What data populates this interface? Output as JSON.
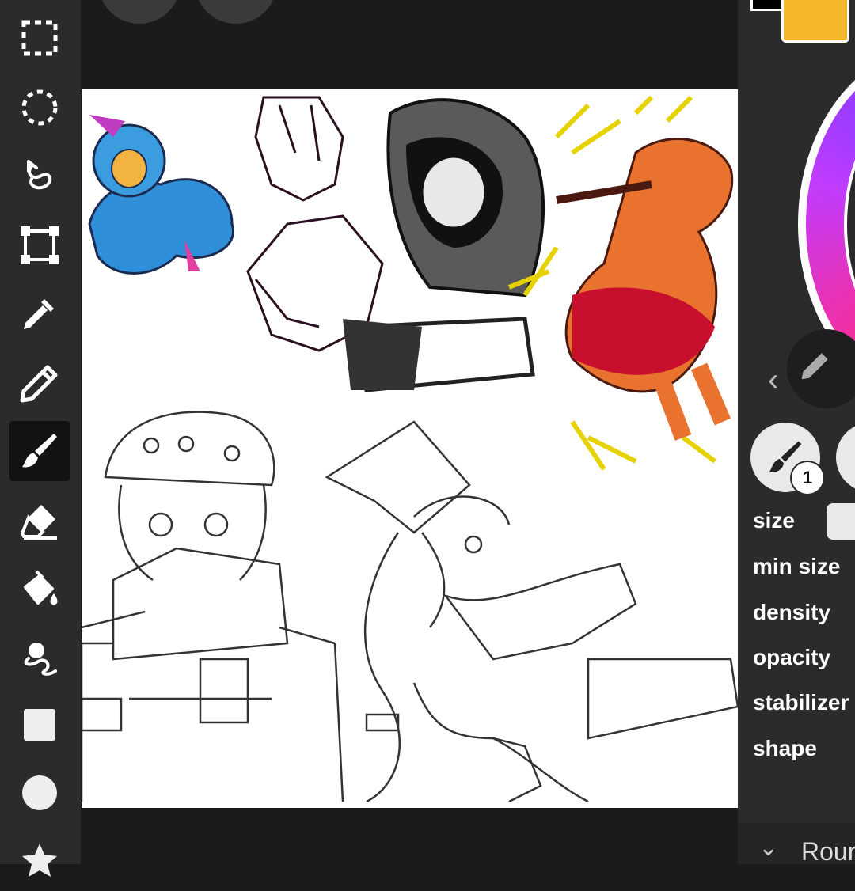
{
  "tools": [
    {
      "name": "rect-select-icon"
    },
    {
      "name": "ellipse-select-icon"
    },
    {
      "name": "lasso-select-icon"
    },
    {
      "name": "transform-icon"
    },
    {
      "name": "eyedropper-icon"
    },
    {
      "name": "pencil-icon"
    },
    {
      "name": "brush-icon",
      "active": true
    },
    {
      "name": "eraser-icon"
    },
    {
      "name": "fill-bucket-icon"
    },
    {
      "name": "smudge-icon"
    },
    {
      "name": "rectangle-shape-icon"
    },
    {
      "name": "ellipse-shape-icon"
    },
    {
      "name": "star-shape-icon"
    }
  ],
  "panel": {
    "primary_color": "#000000",
    "secondary_color": "#f4b82a",
    "brush_count": "1",
    "properties": [
      "size",
      "min size",
      "density",
      "opacity",
      "stabilizer",
      "shape"
    ],
    "shape_dropdown": "Rour"
  },
  "colors": {
    "background": "#1b1b1d",
    "toolbar": "#2b2b2d",
    "active_tool": "#121214"
  }
}
